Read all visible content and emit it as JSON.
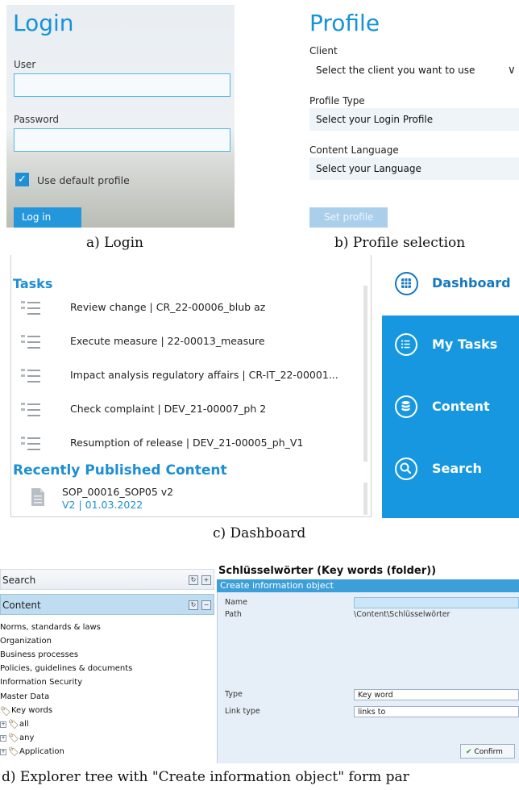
{
  "login": {
    "title": "Login",
    "user_label": "User",
    "password_label": "Password",
    "default_profile_label": "Use default profile",
    "login_button": "Log in",
    "caption": "a) Login"
  },
  "profile": {
    "title": "Profile",
    "client_label": "Client",
    "client_value": "Select the client you want to use",
    "profile_type_label": "Profile Type",
    "profile_type_value": "Select your Login Profile",
    "content_language_label": "Content Language",
    "content_language_value": "Select your Language",
    "set_profile_button": "Set profile",
    "caption": "b) Profile selection"
  },
  "dashboard": {
    "tasks_header": "Tasks",
    "tasks": [
      "Review change | CR_22-00006_blub az",
      "Execute measure | 22-00013_measure",
      "Impact analysis regulatory affairs | CR-IT_22-00001...",
      "Check complaint | DEV_21-00007_ph 2",
      "Resumption of release | DEV_21-00005_ph_V1"
    ],
    "recent_header": "Recently Published Content",
    "recent_item": {
      "name": "SOP_00016_SOP05 v2",
      "meta": "V2 | 01.03.2022"
    },
    "nav": {
      "dashboard": "Dashboard",
      "my_tasks": "My Tasks",
      "content": "Content",
      "search": "Search"
    },
    "caption": "c) Dashboard"
  },
  "explorer": {
    "search_header": "Search",
    "content_header": "Content",
    "tree": [
      "Norms, standards & laws",
      "Organization",
      "Business processes",
      "Policies, guidelines & documents",
      "Information Security",
      "Master Data",
      "Key words",
      "all",
      "any",
      "Application"
    ],
    "form": {
      "title": "Schlüsselwörter (Key words (folder))",
      "bar_title": "Create information object",
      "name_label": "Name",
      "path_label": "Path",
      "path_value": "\\Content\\Schlüsselwörter",
      "type_label": "Type",
      "type_value": "Key word",
      "link_type_label": "Link type",
      "link_type_value": "links to",
      "confirm_button": "Confirm"
    },
    "caption": "d) Explorer tree with \"Create information object\" form par"
  },
  "colors": {
    "accent": "#1592d8",
    "nav_bg": "#1697df",
    "form_bar": "#3d9fd9"
  }
}
